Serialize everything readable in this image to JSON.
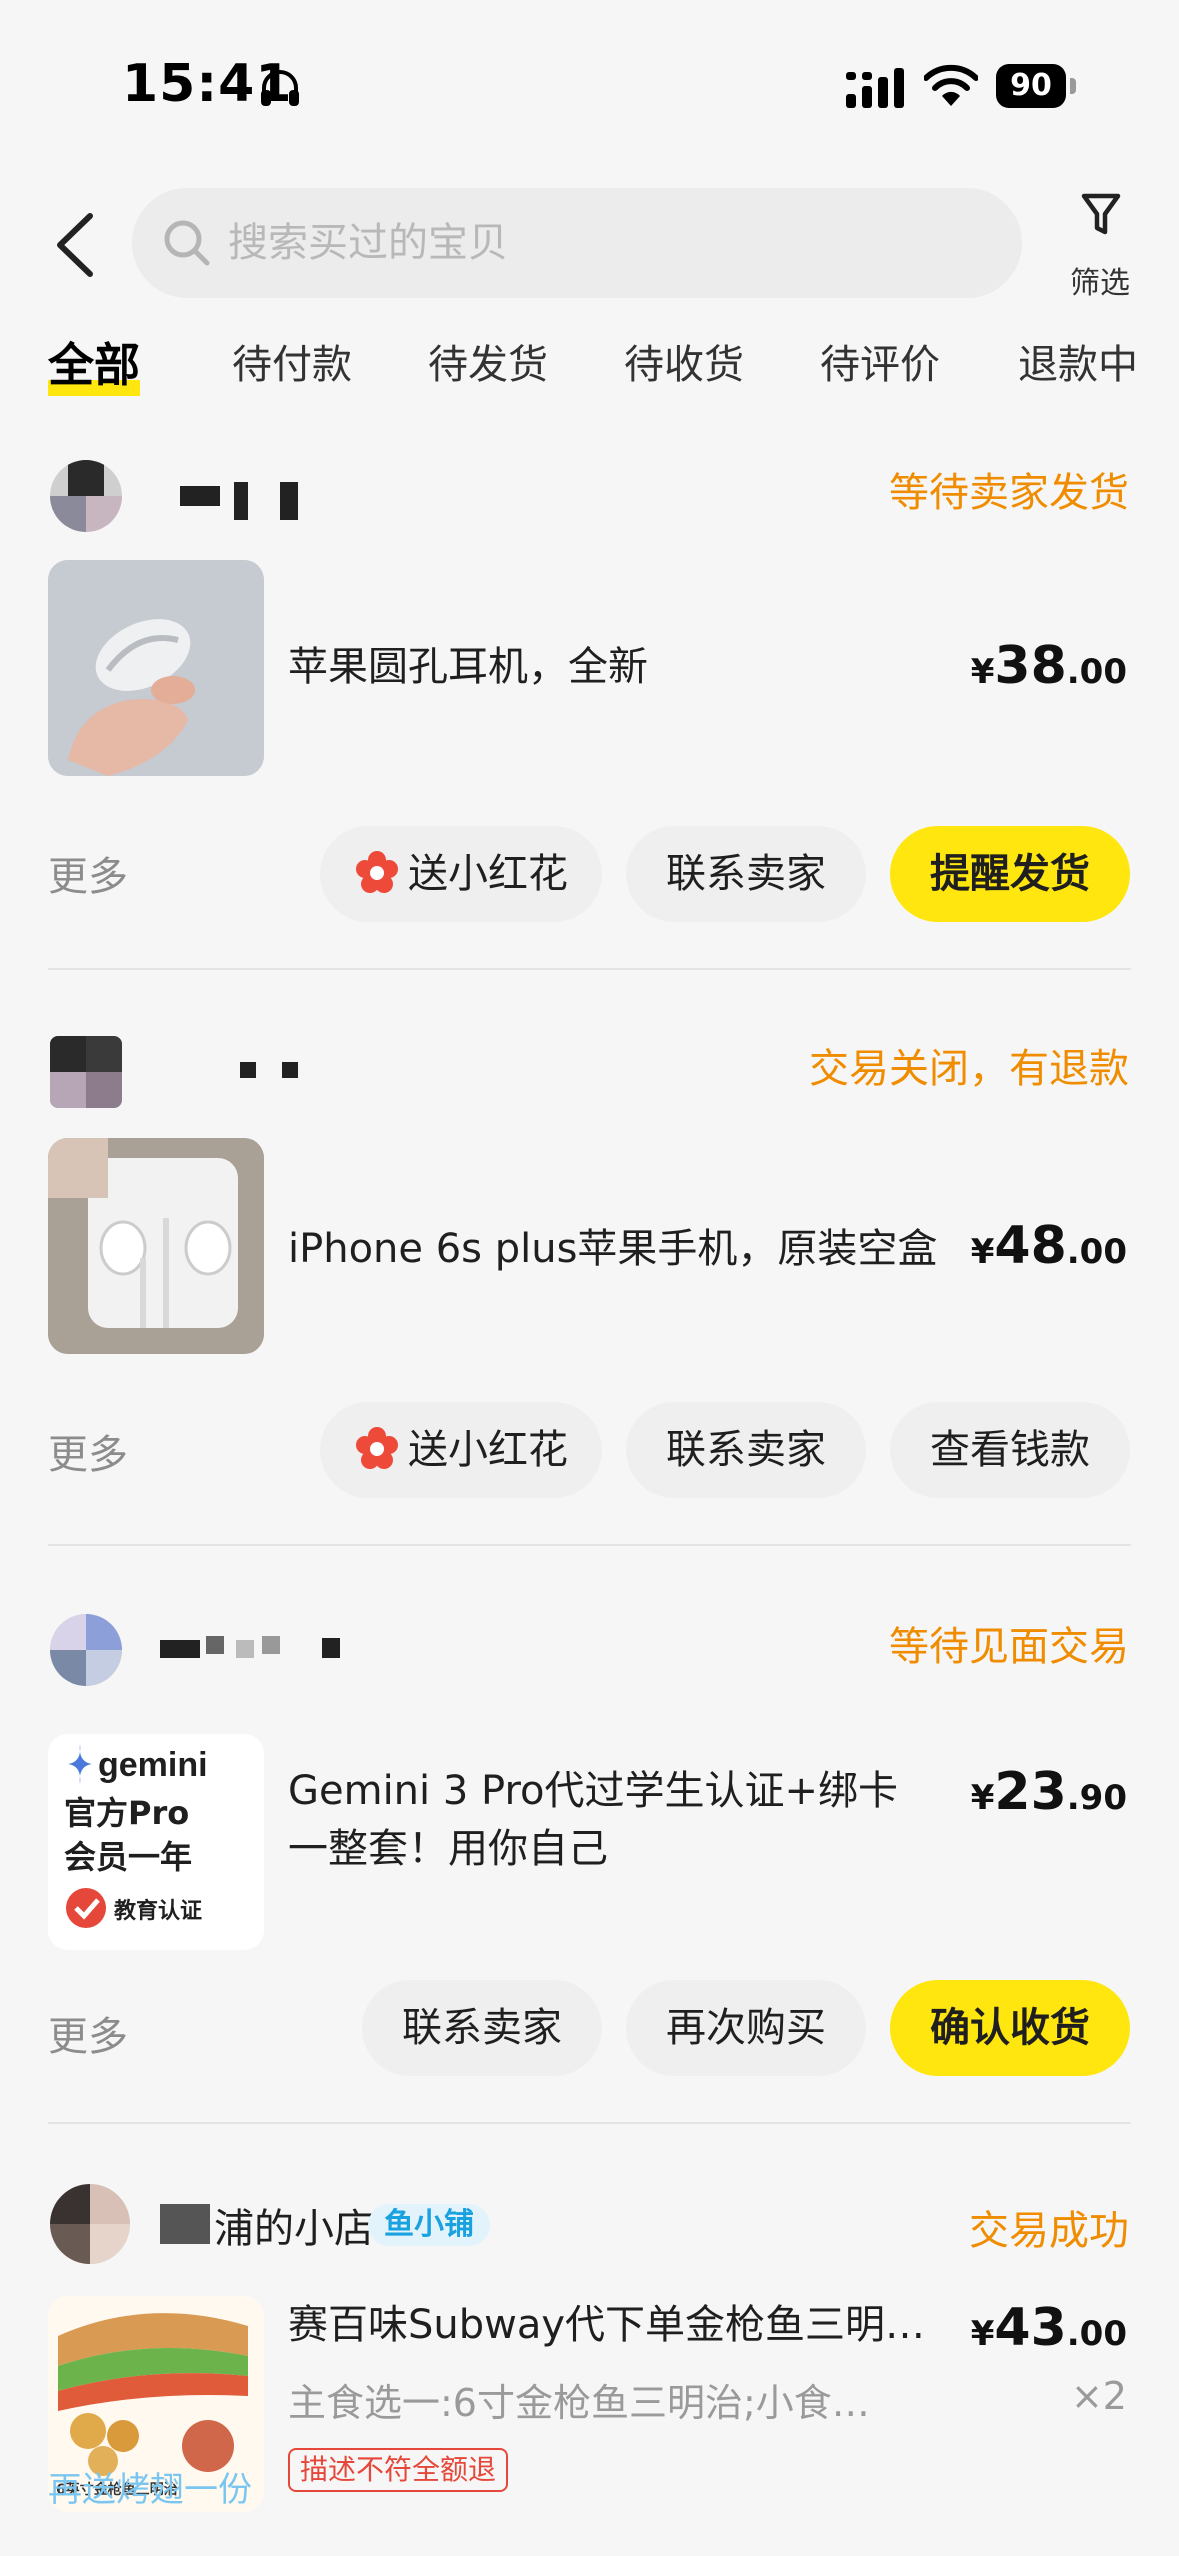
{
  "status_bar": {
    "time": "15:41",
    "battery": "90"
  },
  "header": {
    "search_placeholder": "搜索买过的宝贝",
    "filter_label": "筛选"
  },
  "tabs": [
    {
      "label": "全部",
      "active": true
    },
    {
      "label": "待付款"
    },
    {
      "label": "待发货"
    },
    {
      "label": "待收货"
    },
    {
      "label": "待评价"
    },
    {
      "label": "退款中"
    }
  ],
  "orders": [
    {
      "status": "等待卖家发货",
      "title": "苹果圆孔耳机，全新",
      "price_currency": "¥",
      "price_int": "38",
      "price_dec": ".00",
      "more": "更多",
      "buttons": [
        "送小红花",
        "联系卖家",
        "提醒发货"
      ]
    },
    {
      "status": "交易关闭，有退款",
      "title": "iPhone 6s plus苹果手机，原装空盒",
      "price_currency": "¥",
      "price_int": "48",
      "price_dec": ".00",
      "more": "更多",
      "buttons": [
        "送小红花",
        "联系卖家",
        "查看钱款"
      ]
    },
    {
      "status": "等待见面交易",
      "title_line1": "Gemini 3 Pro代过学生认证+绑卡",
      "title_line2": "一整套！用你自己",
      "price_currency": "¥",
      "price_int": "23",
      "price_dec": ".90",
      "more": "更多",
      "buttons": [
        "联系卖家",
        "再次购买",
        "确认收货"
      ],
      "thumb_text": {
        "brand": "gemini",
        "line1": "官方Pro",
        "line2": "会员一年",
        "badge": "教育认证"
      }
    },
    {
      "shop_name": "浦的小店",
      "shop_tag": "鱼小铺",
      "status": "交易成功",
      "title": "赛百味Subway代下单金枪鱼三明…",
      "subtitle": "主食选一:6寸金枪鱼三明治;小食…",
      "price_currency": "¥",
      "price_int": "43",
      "price_dec": ".00",
      "qty": "×2",
      "refund_tag": "描述不符全额退",
      "promo": "再送烤翅一份",
      "thumb_caption": "6英寸金枪鱼三明治"
    }
  ],
  "colors": {
    "accent_yellow": "#ffe60f",
    "status_orange": "#f08c00",
    "flower_red": "#ee4a3a"
  }
}
